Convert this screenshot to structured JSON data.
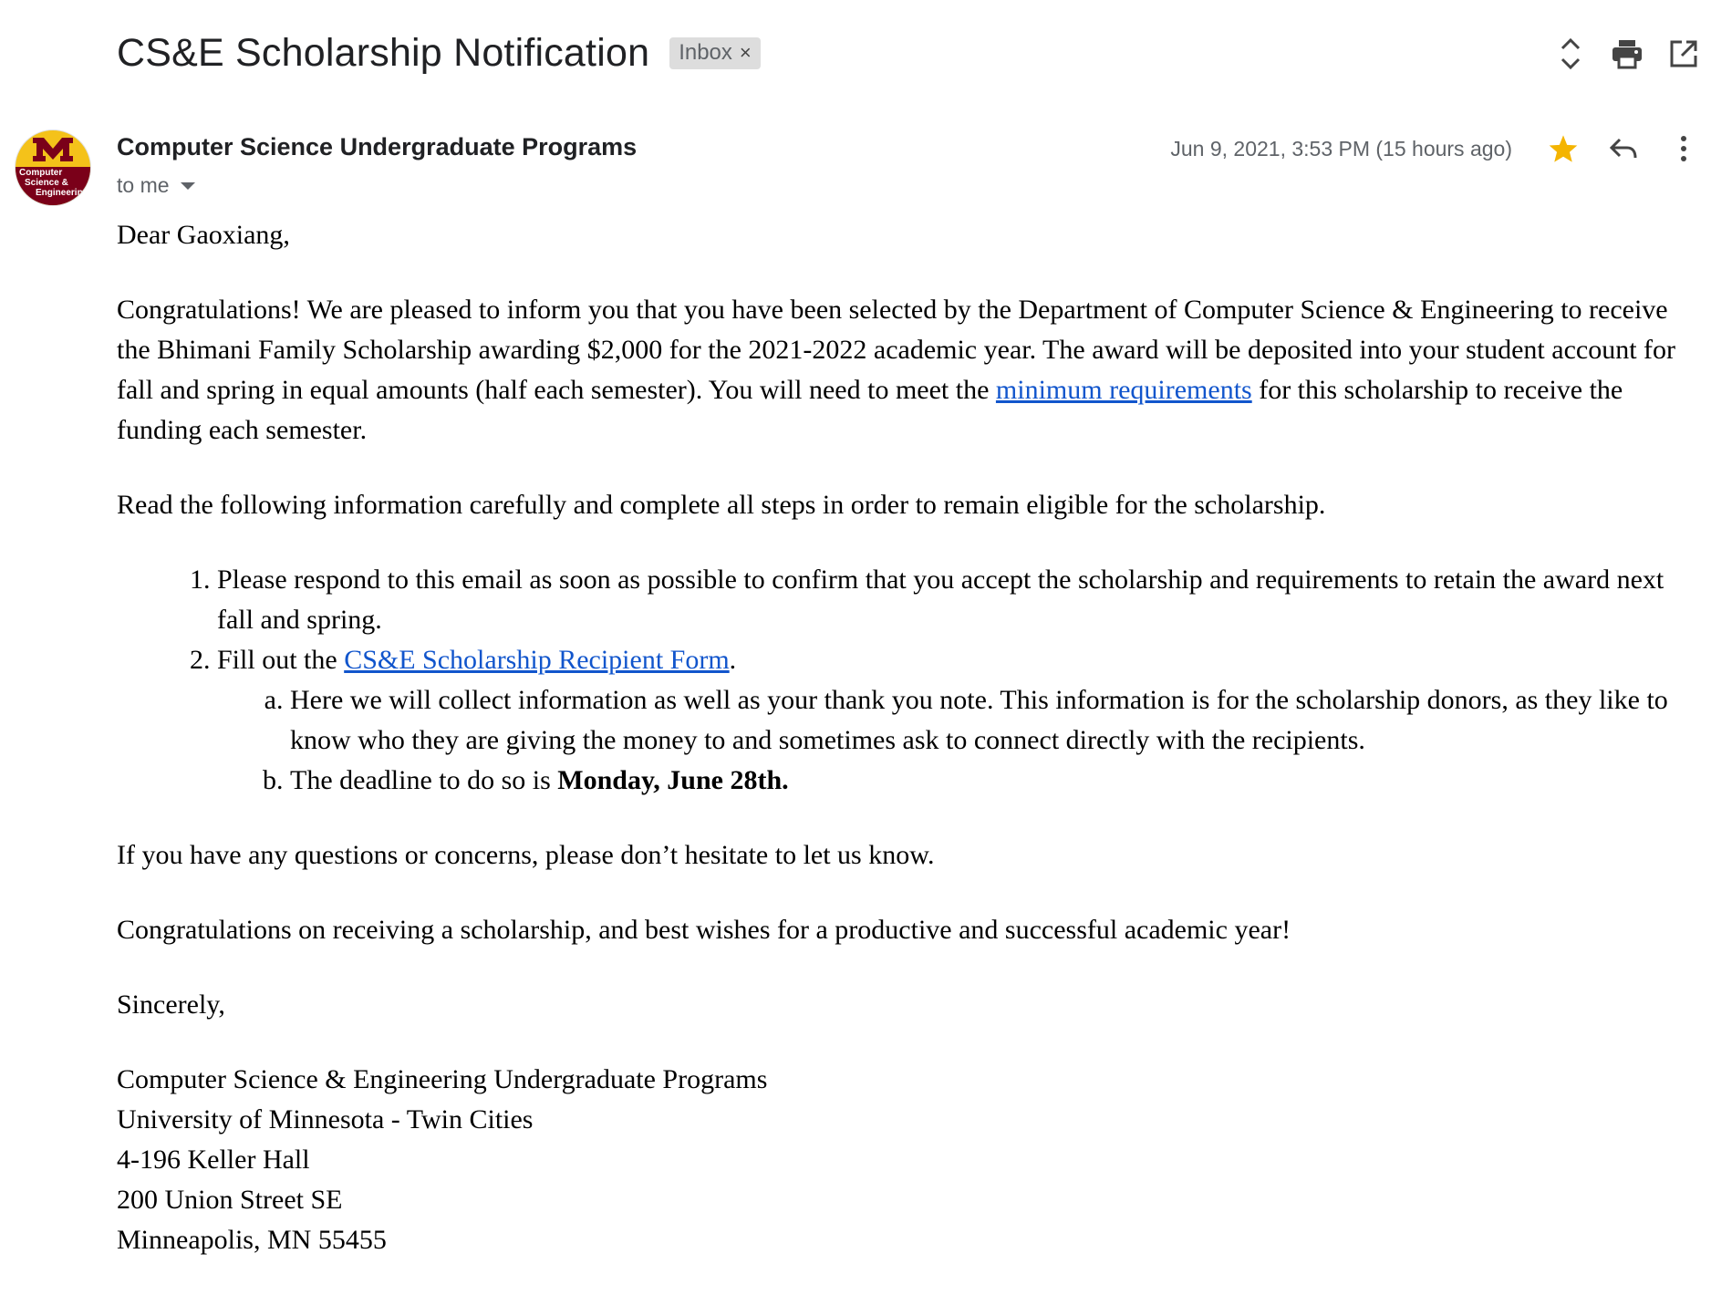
{
  "header": {
    "subject": "CS&E Scholarship Notification",
    "label": "Inbox",
    "label_remove": "×",
    "icons": [
      "expand-collapse-icon",
      "print-icon",
      "open-new-window-icon"
    ]
  },
  "message": {
    "sender_name": "Computer Science Undergraduate Programs",
    "avatar_text": [
      "Computer",
      "Science &",
      "Engineering"
    ],
    "recipient": "to me",
    "date": "Jun 9, 2021, 3:53 PM (15 hours ago)",
    "starred": true,
    "accent_colors": {
      "star": "#f4b400",
      "avatar_gold": "#f4c21a",
      "avatar_maroon": "#7a0019",
      "link": "#1155cc"
    }
  },
  "body": {
    "greeting": "Dear Gaoxiang,",
    "para1_a": "Congratulations! We are pleased to inform you that you have been selected by the Department of Computer Science & Engineering to receive the Bhimani Family Scholarship awarding $2,000 for the 2021-2022 academic year. The award will be deposited into your student account for fall and spring in equal amounts (half each semester). You will need to meet the ",
    "para1_link": "minimum requirements",
    "para1_b": " for this scholarship to receive the funding each semester.",
    "para2": "Read the following information carefully and complete all steps in order to remain eligible for the scholarship.",
    "step1": "Please respond to this email as soon as possible to confirm that you accept the scholarship and requirements to retain the award next fall and spring.",
    "step2_a": "Fill out the ",
    "step2_link": "CS&E Scholarship Recipient Form",
    "step2_b": ".",
    "step2_sub_a": "Here we will collect information as well as your thank you note. This information is for the scholarship donors, as they like to know who they are giving the money to and sometimes ask to connect directly with the recipients.",
    "step2_sub_b_a": "The deadline to do so is ",
    "step2_sub_b_bold": "Monday, June 28th.",
    "para3": "If you have any questions or concerns, please don’t hesitate to let us know.",
    "para4": "Congratulations on receiving a scholarship, and best wishes for a productive and successful academic year!",
    "closing": "Sincerely,",
    "signature": [
      "Computer Science & Engineering Undergraduate Programs",
      "University of Minnesota - Twin Cities",
      "4-196 Keller Hall",
      "200 Union Street SE",
      "Minneapolis, MN 55455"
    ]
  }
}
